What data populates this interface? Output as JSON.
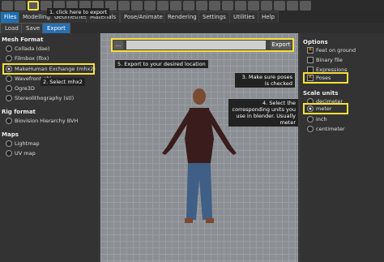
{
  "tabs": [
    "Files",
    "Modelling",
    "Geometries",
    "Materials",
    "Pose/Animate",
    "Rendering",
    "Settings",
    "Utilities",
    "Help"
  ],
  "subtabs": [
    "Load",
    "Save",
    "Export"
  ],
  "mesh_format": {
    "title": "Mesh Format",
    "options": [
      "Collada (dae)",
      "Filmbox (fbx)",
      "MakeHuman Exchange (mhx2)",
      "Wavefront obj",
      "Ogre3D",
      "Stereolithography (stl)"
    ]
  },
  "rig_format": {
    "title": "Rig format",
    "options": [
      "Biovision Hierarchy BVH"
    ]
  },
  "maps": {
    "title": "Maps",
    "options": [
      "Lightmap",
      "UV map"
    ]
  },
  "export_bar": {
    "browse": "...",
    "button": "Export"
  },
  "options": {
    "title": "Options",
    "items": [
      "Feet on ground",
      "Binary file",
      "Expressions",
      "Poses"
    ]
  },
  "scale_units": {
    "title": "Scale units",
    "items": [
      "decimeter",
      "meter",
      "inch",
      "centimeter"
    ]
  },
  "callouts": {
    "c1": "1. click here to export",
    "c2": "2. Select mhx2",
    "c3": "3. Make sure poses is checked",
    "c4": "4. Select the corresponding units you use in blender. Usually meter",
    "c5": "5. Export to your desired location"
  }
}
